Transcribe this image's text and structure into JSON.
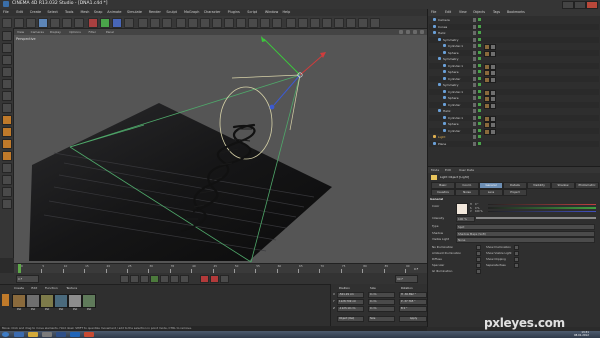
{
  "window": {
    "title": "CINEMA 4D R13.032 Studio - [DNA1.c4d *]"
  },
  "menubar": {
    "items": [
      "File",
      "Edit",
      "Create",
      "Select",
      "Tools",
      "Mesh",
      "Snap",
      "Animate",
      "Simulate",
      "Render",
      "Sculpt",
      "MoGraph",
      "Character",
      "Plugins",
      "Script",
      "Window",
      "Help"
    ]
  },
  "viewport": {
    "menu": [
      "View",
      "Cameras",
      "Display",
      "Options",
      "Filter",
      "Panel"
    ],
    "label": "Perspective"
  },
  "timeline": {
    "ticks": [
      "0",
      "5",
      "10",
      "15",
      "20",
      "25",
      "30",
      "35",
      "40",
      "45",
      "50",
      "55",
      "60",
      "65",
      "70",
      "75",
      "80",
      "85",
      "90"
    ],
    "end_label": "0 F"
  },
  "transport": {
    "start": "0 F",
    "end": "90 F"
  },
  "material_manager": {
    "menu": [
      "Create",
      "Edit",
      "Function",
      "Texture"
    ],
    "materials": [
      {
        "name": "Mat",
        "color": "#8a6a3c"
      },
      {
        "name": "Mat",
        "color": "#6f6f6f"
      },
      {
        "name": "Mat",
        "color": "#7d7b4a"
      },
      {
        "name": "Mat",
        "color": "#4a6a7d"
      },
      {
        "name": "Mat",
        "color": "#8d8d8d"
      },
      {
        "name": "Mat",
        "color": "#5f7a5a"
      }
    ]
  },
  "coordinates": {
    "headers": [
      "Position",
      "Size",
      "Rotation"
    ],
    "rows": [
      {
        "p": "-501.29 cm",
        "s": "0 cm",
        "r": "H -30.892 °"
      },
      {
        "p": "1128.709 cm",
        "s": "0 cm",
        "r": "P -37.765 °"
      },
      {
        "p": "-1123.19 cm",
        "s": "0 cm",
        "r": "B 0 °"
      }
    ],
    "mode_object": "Object (Rel)",
    "mode_size": "Size",
    "apply": "Apply"
  },
  "status": {
    "text": "Move: Click and drag to move elements. Hold down SHIFT to quantize movement / add to the selection in point mode, CTRL to remove."
  },
  "object_manager": {
    "menu": [
      "File",
      "Edit",
      "View",
      "Objects",
      "Tags",
      "Bookmarks"
    ],
    "rows": [
      {
        "name": "Camera",
        "indent": 0,
        "color": "#d0d0d0"
      },
      {
        "name": "Cones",
        "indent": 0,
        "color": "#d0d0d0"
      },
      {
        "name": "Helix",
        "indent": 0,
        "color": "#d0d0d0"
      },
      {
        "name": "Symmetry",
        "indent": 1,
        "color": "#d0d0d0"
      },
      {
        "name": "Cylinder.1",
        "indent": 2,
        "color": "#d0d0d0"
      },
      {
        "name": "Sphere",
        "indent": 2,
        "color": "#d0d0d0"
      },
      {
        "name": "Symmetry",
        "indent": 1,
        "color": "#d0d0d0"
      },
      {
        "name": "Cylinder.1",
        "indent": 2,
        "color": "#d0d0d0"
      },
      {
        "name": "Sphere",
        "indent": 2,
        "color": "#d0d0d0"
      },
      {
        "name": "Cylinder",
        "indent": 2,
        "color": "#d0d0d0"
      },
      {
        "name": "Symmetry",
        "indent": 1,
        "color": "#d0d0d0"
      },
      {
        "name": "Cylinder.1",
        "indent": 2,
        "color": "#d0d0d0"
      },
      {
        "name": "Sphere",
        "indent": 2,
        "color": "#d0d0d0"
      },
      {
        "name": "Cylinder",
        "indent": 2,
        "color": "#d0d0d0"
      },
      {
        "name": "Helix",
        "indent": 1,
        "color": "#d0d0d0"
      },
      {
        "name": "Cylinder.1",
        "indent": 2,
        "color": "#d0d0d0"
      },
      {
        "name": "Sphere",
        "indent": 2,
        "color": "#d0d0d0"
      },
      {
        "name": "Cylinder",
        "indent": 2,
        "color": "#d0d0d0"
      },
      {
        "name": "Light",
        "indent": 0,
        "color": "#e0b050"
      },
      {
        "name": "Plane",
        "indent": 0,
        "color": "#d0d0d0"
      }
    ]
  },
  "attribute_manager": {
    "menu": [
      "Mode",
      "Edit",
      "User Data"
    ],
    "object_title": "Light Object [Light]",
    "tabs_row1": [
      "Basic",
      "Coord.",
      "General",
      "Details",
      "Visibility",
      "Shadow",
      "Photometric"
    ],
    "tabs_row2": [
      "Caustics",
      "Noise",
      "Lens",
      "Project"
    ],
    "active_tab": "General",
    "section": "General",
    "fields": [
      {
        "label": "Color",
        "value": ""
      },
      {
        "label": "Intensity",
        "value": "100 %"
      },
      {
        "label": "Type",
        "value": "Spot"
      },
      {
        "label": "Shadow",
        "value": "Shadow Maps (Soft)"
      },
      {
        "label": "Visible Light",
        "value": "None"
      }
    ],
    "checks": [
      {
        "label": "No Illumination",
        "right": "Show Illumination"
      },
      {
        "label": "Ambient Illumination",
        "right": "Show Visible Light"
      },
      {
        "label": "Diffuse",
        "right": "Show Clipping"
      },
      {
        "label": "Specular",
        "right": "Separate Pass"
      },
      {
        "label": "GI Illumination",
        "right": ""
      }
    ],
    "hsv": [
      "H",
      "S",
      "V"
    ],
    "hsv_values": [
      "0 °",
      "0 %",
      "100 %"
    ]
  },
  "taskbar": {
    "time": "13:31",
    "date": "08.01.2012"
  },
  "watermark": "pxleyes.com"
}
